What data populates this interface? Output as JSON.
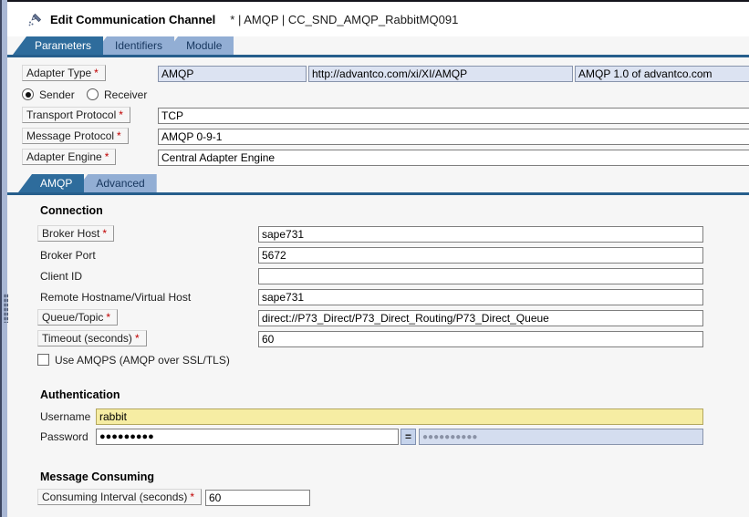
{
  "header": {
    "title": "Edit Communication Channel",
    "subtitle": "* | AMQP | CC_SND_AMQP_RabbitMQ091"
  },
  "tabs": [
    {
      "label": "Parameters",
      "active": true
    },
    {
      "label": "Identifiers",
      "active": false
    },
    {
      "label": "Module",
      "active": false
    }
  ],
  "subtabs": [
    {
      "label": "AMQP",
      "active": true
    },
    {
      "label": "Advanced",
      "active": false
    }
  ],
  "ui": {
    "required_marker": "*",
    "equals_label": "="
  },
  "general": {
    "adapter_type_label": "Adapter Type",
    "adapter_type_name": "AMQP",
    "adapter_type_namespace": "http://advantco.com/xi/XI/AMQP",
    "adapter_type_version": "AMQP 1.0 of advantco.com",
    "sender_label": "Sender",
    "receiver_label": "Receiver",
    "transport_protocol_label": "Transport Protocol",
    "transport_protocol_value": "TCP",
    "message_protocol_label": "Message Protocol",
    "message_protocol_value": "AMQP 0-9-1",
    "adapter_engine_label": "Adapter Engine",
    "adapter_engine_value": "Central Adapter Engine"
  },
  "connection": {
    "heading": "Connection",
    "broker_host_label": "Broker Host",
    "broker_host_value": "sape731",
    "broker_port_label": "Broker Port",
    "broker_port_value": "5672",
    "client_id_label": "Client ID",
    "client_id_value": "",
    "remote_host_label": "Remote Hostname/Virtual Host",
    "remote_host_value": "sape731",
    "queue_topic_label": "Queue/Topic",
    "queue_topic_value": "direct://P73_Direct/P73_Direct_Routing/P73_Direct_Queue",
    "timeout_label": "Timeout (seconds)",
    "timeout_value": "60",
    "use_amqps_label": "Use AMQPS (AMQP over SSL/TLS)",
    "use_amqps_checked": false
  },
  "authentication": {
    "heading": "Authentication",
    "username_label": "Username",
    "username_value": "rabbit",
    "password_label": "Password",
    "password_masked": "●●●●●●●●●",
    "password_confirm_masked": "●●●●●●●●●●"
  },
  "message_consuming": {
    "heading": "Message Consuming",
    "interval_label": "Consuming Interval (seconds)",
    "interval_value": "60"
  },
  "colors": {
    "active_tab": "#2e6c9c",
    "inactive_tab": "#92aed4",
    "tab_underline": "#265e8c",
    "readonly_field_bg": "#dce3f2",
    "username_highlight_bg": "#f6eda3",
    "confirm_field_bg": "#d4ddef",
    "required_marker": "#c00000",
    "splitter": "#a9b7d4"
  }
}
